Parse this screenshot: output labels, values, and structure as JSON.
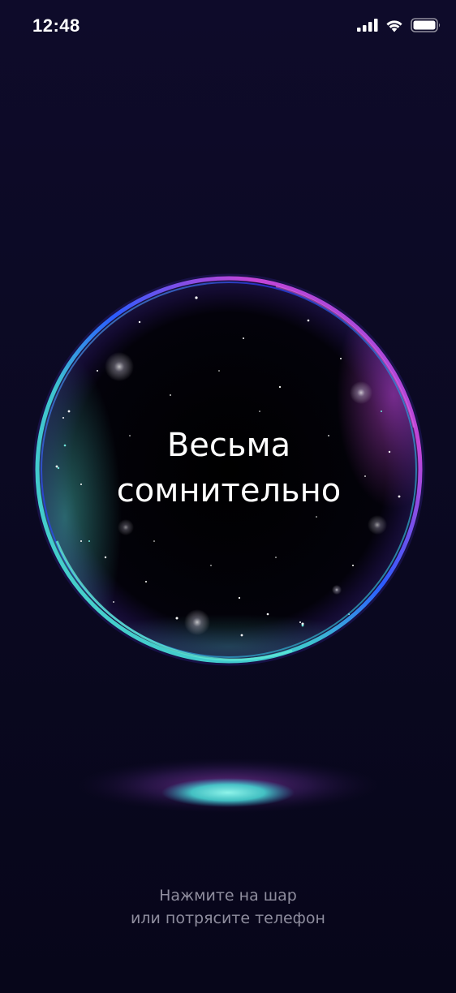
{
  "status_bar": {
    "time": "12:48",
    "icons": [
      "signal-icon",
      "wifi-icon",
      "battery-icon"
    ]
  },
  "magic_ball": {
    "answer_line1": "Весьма",
    "answer_line2": "сомнительно",
    "colors": {
      "rim_cyan": "#49d6c8",
      "rim_magenta": "#c445d6",
      "rim_blue": "#2b5cff",
      "inner": "#000000"
    }
  },
  "hint": {
    "line1": "Нажмите на шар",
    "line2": "или потрясите телефон"
  },
  "theme": {
    "background_top": "#0e0b2a",
    "background_bottom": "#07061a",
    "hint_color": "#8f8d9e"
  }
}
